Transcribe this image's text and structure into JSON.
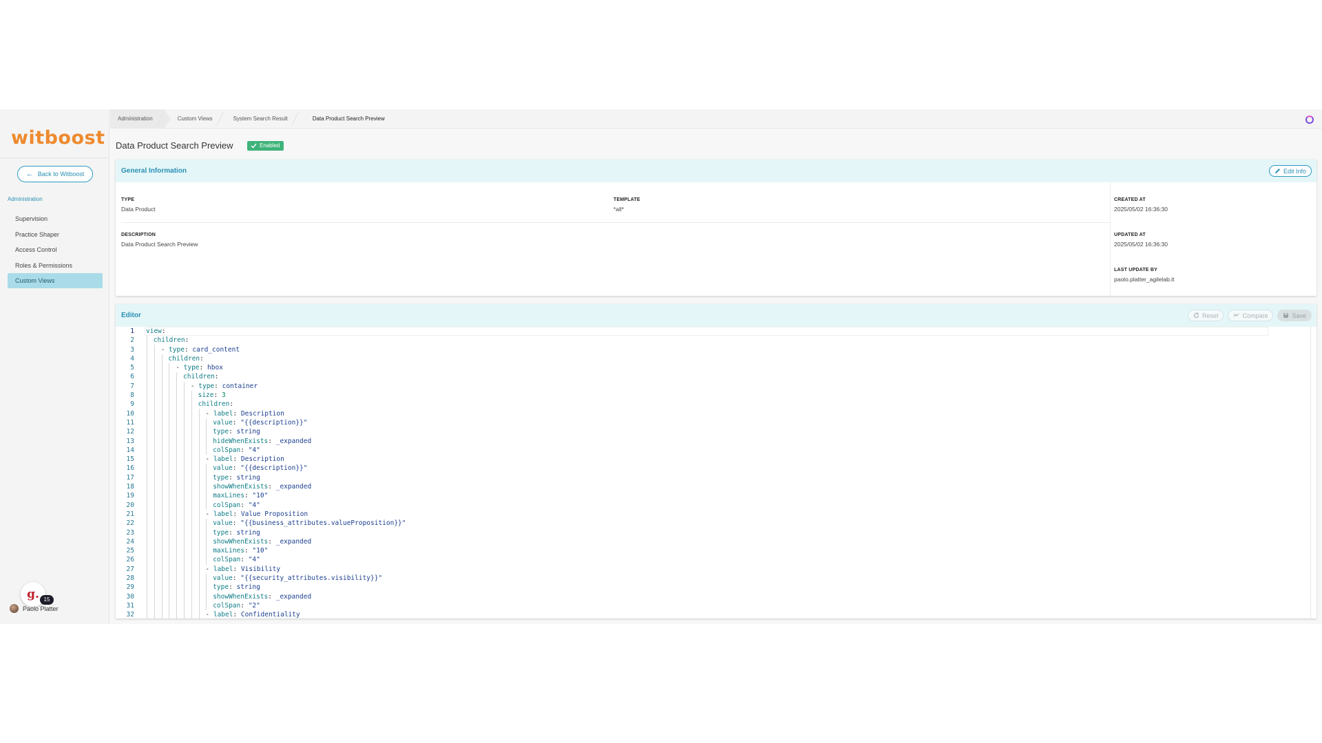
{
  "sidebar": {
    "logo": "witboost",
    "back_label": "Back to Witboost",
    "section_label": "Administration",
    "items": [
      {
        "label": "Supervision",
        "active": false
      },
      {
        "label": "Practice Shaper",
        "active": false
      },
      {
        "label": "Access Control",
        "active": false
      },
      {
        "label": "Roles & Permissions",
        "active": false
      },
      {
        "label": "Custom Views",
        "active": true
      }
    ],
    "notification_count": "15",
    "user_name": "Paolo Platter"
  },
  "breadcrumb": [
    "Administration",
    "Custom Views",
    "System Search Result",
    "Data Product Search Preview"
  ],
  "page": {
    "title": "Data Product Search Preview",
    "status": "Enabled"
  },
  "general_info": {
    "header": "General Information",
    "edit_label": "Edit Info",
    "type_label": "TYPE",
    "type_value": "Data Product",
    "template_label": "TEMPLATE",
    "template_value": "*all*",
    "description_label": "DESCRIPTION",
    "description_value": "Data Product Search Preview",
    "created_label": "CREATED AT",
    "created_value": "2025/05/02 16:36:30",
    "updated_label": "UPDATED AT",
    "updated_value": "2025/05/02 16:36:30",
    "last_update_label": "LAST UPDATE BY",
    "last_update_value": "paolo.platter_agilelab.it"
  },
  "editor": {
    "header": "Editor",
    "reset_label": "Reset",
    "compare_label": "Compare",
    "save_label": "Save",
    "lines": [
      {
        "indent": 0,
        "text": "view:"
      },
      {
        "indent": 1,
        "text": "children:"
      },
      {
        "indent": 2,
        "text": "- type: card_content"
      },
      {
        "indent": 3,
        "text": "children:"
      },
      {
        "indent": 4,
        "text": "- type: hbox"
      },
      {
        "indent": 5,
        "text": "children:"
      },
      {
        "indent": 6,
        "text": "- type: container"
      },
      {
        "indent": 7,
        "text": "size: 3"
      },
      {
        "indent": 7,
        "text": "children:"
      },
      {
        "indent": 8,
        "text": "- label: Description"
      },
      {
        "indent": 9,
        "text": "value: \"{{description}}\""
      },
      {
        "indent": 9,
        "text": "type: string"
      },
      {
        "indent": 9,
        "text": "hideWhenExists: _expanded"
      },
      {
        "indent": 9,
        "text": "colSpan: \"4\""
      },
      {
        "indent": 8,
        "text": "- label: Description"
      },
      {
        "indent": 9,
        "text": "value: \"{{description}}\""
      },
      {
        "indent": 9,
        "text": "type: string"
      },
      {
        "indent": 9,
        "text": "showWhenExists: _expanded"
      },
      {
        "indent": 9,
        "text": "maxLines: \"10\""
      },
      {
        "indent": 9,
        "text": "colSpan: \"4\""
      },
      {
        "indent": 8,
        "text": "- label: Value Proposition"
      },
      {
        "indent": 9,
        "text": "value: \"{{business_attributes.valueProposition}}\""
      },
      {
        "indent": 9,
        "text": "type: string"
      },
      {
        "indent": 9,
        "text": "showWhenExists: _expanded"
      },
      {
        "indent": 9,
        "text": "maxLines: \"10\""
      },
      {
        "indent": 9,
        "text": "colSpan: \"4\""
      },
      {
        "indent": 8,
        "text": "- label: Visibility"
      },
      {
        "indent": 9,
        "text": "value: \"{{security_attributes.visibility}}\""
      },
      {
        "indent": 9,
        "text": "type: string"
      },
      {
        "indent": 9,
        "text": "showWhenExists: _expanded"
      },
      {
        "indent": 9,
        "text": "colSpan: \"2\""
      },
      {
        "indent": 8,
        "text": "- label: Confidentiality"
      }
    ]
  },
  "colors": {
    "accent": "#2a8fb4",
    "brand": "#ee8a2e",
    "active_nav": "#a9dbe8",
    "status_green": "#3fb37a"
  }
}
